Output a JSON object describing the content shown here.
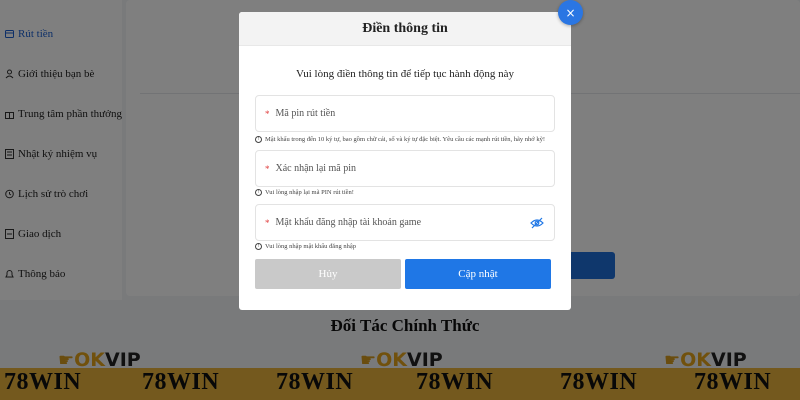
{
  "sidebar": {
    "items": [
      {
        "label": "Rút tiền",
        "icon": "wallet-icon",
        "active": true
      },
      {
        "label": "Giới thiệu bạn bè",
        "icon": "user-icon"
      },
      {
        "label": "Trung tâm phần thưởng",
        "icon": "gift-icon"
      },
      {
        "label": "Nhật ký nhiệm vụ",
        "icon": "list-icon"
      },
      {
        "label": "Lịch sử trò chơi",
        "icon": "history-icon"
      },
      {
        "label": "Giao dịch",
        "icon": "transaction-icon"
      },
      {
        "label": "Thông báo",
        "icon": "bell-icon"
      }
    ]
  },
  "partners": {
    "title": "Đối Tác Chính Thức",
    "logo_ok": "OK",
    "logo_vip": "VIP",
    "brand": "78WIN"
  },
  "modal": {
    "title": "Điền thông tin",
    "subtitle": "Vui lòng điền thông tin để tiếp tục hành động này",
    "required_mark": "*",
    "fields": [
      {
        "placeholder": "Mã pin rút tiền",
        "hint": "Mật khẩu trong đến 10 ký tự, bao gồm chữ cái, số và ký tự đặc biệt. Yêu cầu các mạnh rút tiền, hãy nhớ kỹ!"
      },
      {
        "placeholder": "Xác nhận lại mã pin",
        "hint": "Vui lòng nhập lại mã PIN rút tiền!"
      },
      {
        "placeholder": "Mật khẩu đăng nhập tài khoản game",
        "hint": "Vui lòng nhập mật khẩu đăng nhập"
      }
    ],
    "cancel_label": "Hủy",
    "update_label": "Cập nhật",
    "close_label": "×"
  },
  "colors": {
    "primary": "#1f77e6",
    "brand_bar": "#e8b33d",
    "required": "#e03b3b"
  }
}
